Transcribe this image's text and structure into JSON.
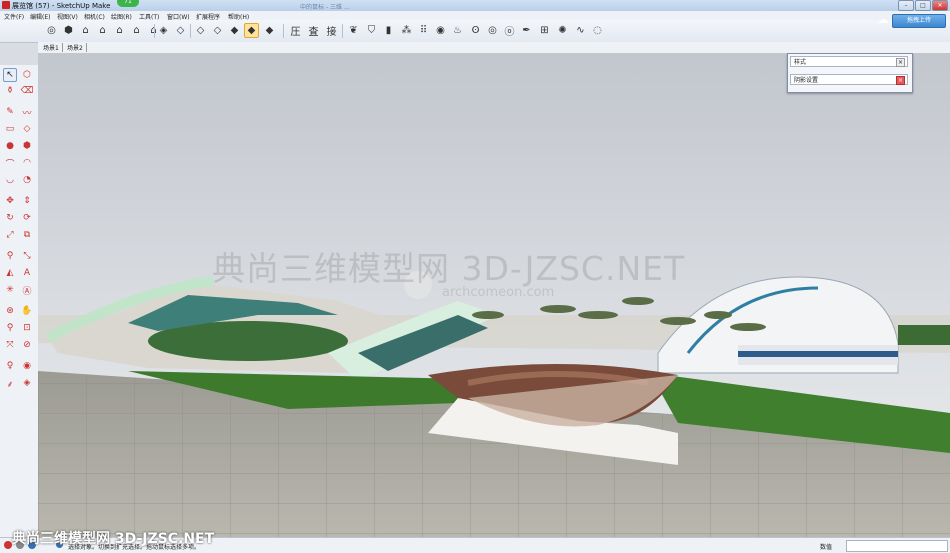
{
  "window": {
    "title": "展览馆 (57) - SketchUp Make",
    "title_blur": "中的鼠标 - 三维 …",
    "badge": "71",
    "controls": [
      "–",
      "□",
      "✕"
    ]
  },
  "menu": [
    "文件(F)",
    "编辑(E)",
    "视图(V)",
    "相机(C)",
    "绘图(R)",
    "工具(T)",
    "窗口(W)",
    "扩展程序",
    "帮助(H)"
  ],
  "scenes": [
    "场景1",
    "场景2"
  ],
  "styles_panel": {
    "title": "样式",
    "item": "阴影设置"
  },
  "upload_button": "拖拽上传",
  "watermark": {
    "main": "典尚三维模型网 3D-JZSC.NET",
    "url": "archcomeon.com",
    "bottom": "典尚三维模型网 3D-JZSC.NET"
  },
  "statusbar": {
    "hint": "选择对象。切换到扩充选择。拖动鼠标选择多项。",
    "measure_label": "数值"
  },
  "colors": {
    "sky_top": "#c7cbd2",
    "grass": "#3f7a2e",
    "paving": "#a7a59c",
    "plaza": "#7a4a3a"
  }
}
